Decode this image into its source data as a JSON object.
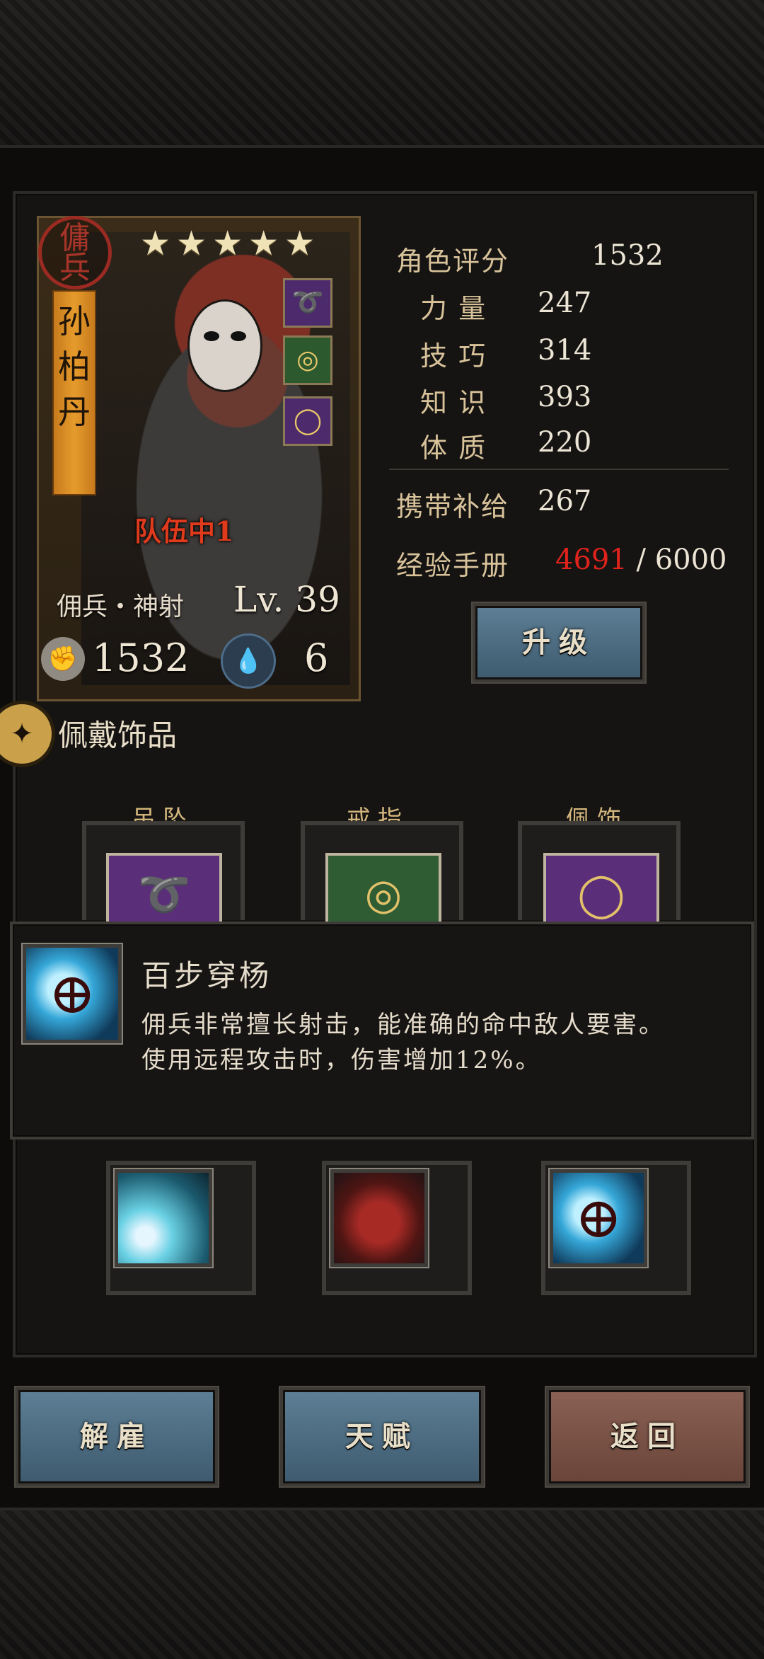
{
  "hero": {
    "seal_text": "傭兵",
    "name": "孙柏丹",
    "stars": 5,
    "team_label": "队伍中1",
    "class_label": "佣兵・神射",
    "level": "Lv. 39",
    "power": "1532",
    "stress": "6"
  },
  "stats": {
    "rating_label": "角色评分",
    "rating_value": "1532",
    "strength_label": "力 量",
    "strength_value": "247",
    "skill_label": "技 巧",
    "skill_value": "314",
    "knowledge_label": "知 识",
    "knowledge_value": "393",
    "constitution_label": "体 质",
    "constitution_value": "220",
    "supply_label": "携带补给",
    "supply_value": "267",
    "exp_label": "经验手册",
    "exp_current": "4691",
    "exp_sep": " / ",
    "exp_max": "6000"
  },
  "buttons": {
    "upgrade": "升级",
    "dismiss": "解雇",
    "talent": "天赋",
    "back": "返回"
  },
  "trinkets": {
    "section_title": "佩戴饰品",
    "pendant_label": "吊坠",
    "ring_label": "戒指",
    "accessory_label": "佩饰"
  },
  "tooltip": {
    "title": "百步穿杨",
    "line1": "佣兵非常擅长射击，能准确的命中敌人要害。",
    "line2": "使用远程攻击时，伤害增加12%。"
  },
  "icons": {
    "star": "★",
    "fist": "✊",
    "drop": "💧",
    "section": "✦",
    "pendant": "➰",
    "ring": "◎",
    "accessory": "◯",
    "crosshair": "⊕"
  },
  "colors": {
    "exp_current": "#e0231c",
    "team_label": "#e03a1d",
    "btn_blue": "#4e6d82",
    "btn_brown": "#7a5246",
    "name_banner": "#e69b2c"
  }
}
